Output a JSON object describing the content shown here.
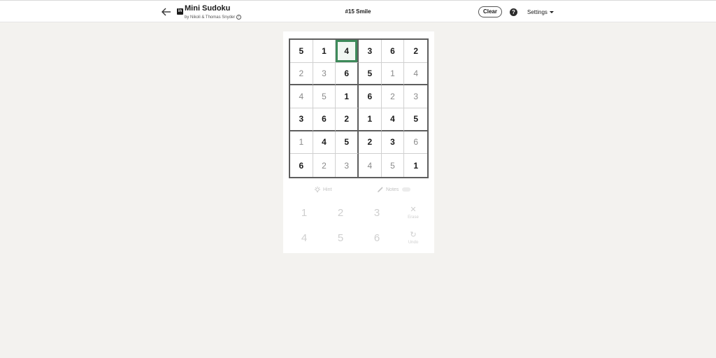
{
  "header": {
    "brand_mark": "in",
    "title": "Mini Sudoku",
    "byline": "by Nikoli & Thomas Snyder",
    "info_glyph": "i",
    "puzzle_title": "#15 Smile",
    "clear_label": "Clear",
    "help_glyph": "?",
    "settings_label": "Settings"
  },
  "board": {
    "selected_cell": {
      "row": 0,
      "col": 2
    },
    "cells": [
      [
        {
          "v": "5",
          "given": true
        },
        {
          "v": "1",
          "given": true
        },
        {
          "v": "4",
          "given": true
        },
        {
          "v": "3",
          "given": true
        },
        {
          "v": "6",
          "given": true
        },
        {
          "v": "2",
          "given": true
        }
      ],
      [
        {
          "v": "2",
          "given": false
        },
        {
          "v": "3",
          "given": false
        },
        {
          "v": "6",
          "given": true
        },
        {
          "v": "5",
          "given": true
        },
        {
          "v": "1",
          "given": false
        },
        {
          "v": "4",
          "given": false
        }
      ],
      [
        {
          "v": "4",
          "given": false
        },
        {
          "v": "5",
          "given": false
        },
        {
          "v": "1",
          "given": true
        },
        {
          "v": "6",
          "given": true
        },
        {
          "v": "2",
          "given": false
        },
        {
          "v": "3",
          "given": false
        }
      ],
      [
        {
          "v": "3",
          "given": true
        },
        {
          "v": "6",
          "given": true
        },
        {
          "v": "2",
          "given": true
        },
        {
          "v": "1",
          "given": true
        },
        {
          "v": "4",
          "given": true
        },
        {
          "v": "5",
          "given": true
        }
      ],
      [
        {
          "v": "1",
          "given": false
        },
        {
          "v": "4",
          "given": true
        },
        {
          "v": "5",
          "given": true
        },
        {
          "v": "2",
          "given": true
        },
        {
          "v": "3",
          "given": true
        },
        {
          "v": "6",
          "given": false
        }
      ],
      [
        {
          "v": "6",
          "given": true
        },
        {
          "v": "2",
          "given": false
        },
        {
          "v": "3",
          "given": false
        },
        {
          "v": "4",
          "given": false
        },
        {
          "v": "5",
          "given": false
        },
        {
          "v": "1",
          "given": true
        }
      ]
    ]
  },
  "tools": {
    "hint_label": "Hint",
    "notes_label": "Notes"
  },
  "numpad": {
    "keys": [
      "1",
      "2",
      "3",
      "4",
      "5",
      "6"
    ],
    "erase_label": "Erase",
    "undo_label": "Undo"
  },
  "colors": {
    "selected_border": "#3d8a5a",
    "thick_grid": "#5e5e5e",
    "page_background": "#f3f2ef"
  }
}
